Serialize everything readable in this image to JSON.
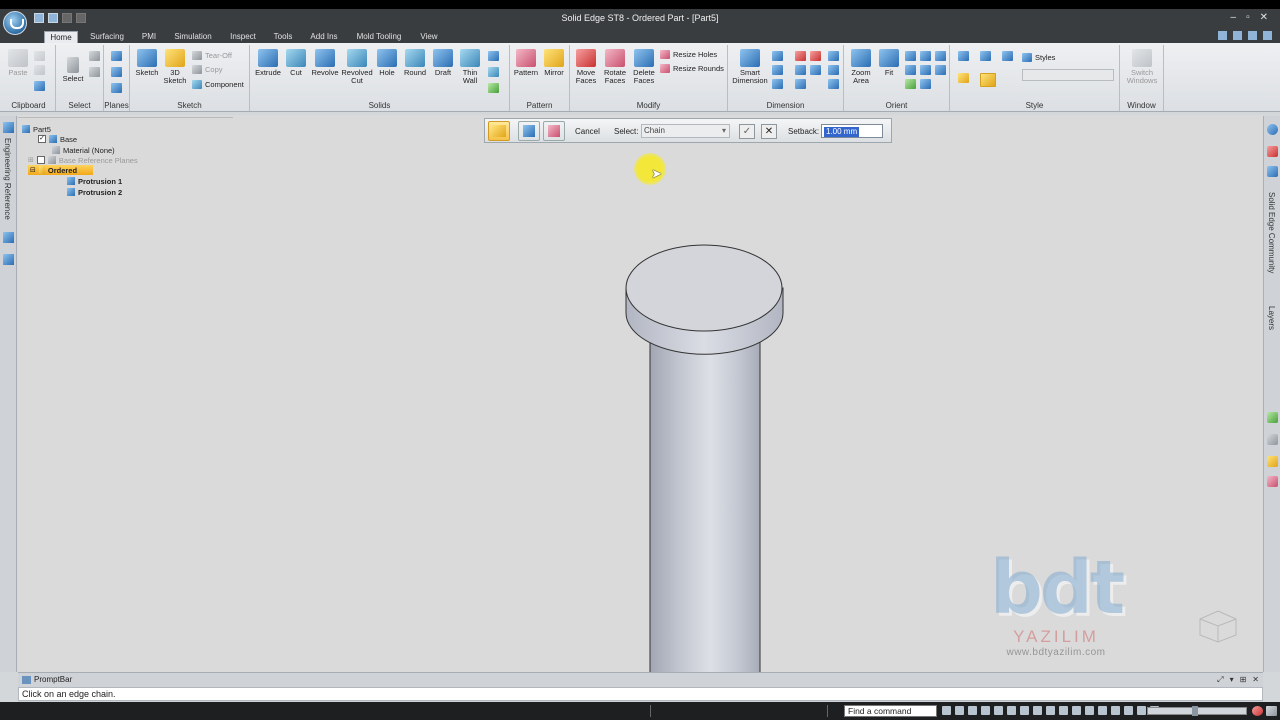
{
  "app": {
    "window_title": "Solid Edge ST8 - Ordered Part - [Part5]",
    "window_controls": [
      "–",
      "▫",
      "✕"
    ]
  },
  "ribbon": {
    "tabs": [
      "Home",
      "Surfacing",
      "PMI",
      "Simulation",
      "Inspect",
      "Tools",
      "Add Ins",
      "Mold Tooling",
      "View"
    ],
    "active_tab": "Home",
    "groups": {
      "clipboard": {
        "label": "Clipboard",
        "paste": "Paste"
      },
      "select": {
        "label": "Select",
        "select": "Select"
      },
      "planes": {
        "label": "Planes"
      },
      "sketch": {
        "label": "Sketch",
        "sketch": "Sketch",
        "sketch3d_l1": "3D",
        "sketch3d_l2": "Sketch",
        "tear_off": "Tear-Off",
        "copy": "Copy",
        "component": "Component"
      },
      "solids": {
        "label": "Solids",
        "extrude": "Extrude",
        "cut": "Cut",
        "revolve": "Revolve",
        "revolved_cut_l1": "Revolved",
        "revolved_cut_l2": "Cut",
        "hole": "Hole",
        "round": "Round",
        "draft": "Draft",
        "thin_wall_l1": "Thin",
        "thin_wall_l2": "Wall"
      },
      "pattern": {
        "label": "Pattern",
        "pattern": "Pattern",
        "mirror": "Mirror"
      },
      "modify": {
        "label": "Modify",
        "move_faces_l1": "Move",
        "move_faces_l2": "Faces",
        "rotate_faces_l1": "Rotate",
        "rotate_faces_l2": "Faces",
        "delete_faces_l1": "Delete",
        "delete_faces_l2": "Faces",
        "resize_holes": "Resize Holes",
        "resize_rounds": "Resize Rounds"
      },
      "dimension": {
        "label": "Dimension",
        "smart_dim_l1": "Smart",
        "smart_dim_l2": "Dimension"
      },
      "orient": {
        "label": "Orient",
        "zoom_area_l1": "Zoom",
        "zoom_area_l2": "Area",
        "fit": "Fit"
      },
      "style": {
        "label": "Style",
        "styles": "Styles"
      },
      "window": {
        "label": "Window",
        "switch_windows_l1": "Switch",
        "switch_windows_l2": "Windows"
      }
    }
  },
  "left_panel": {
    "tab_label": "Engineering Reference"
  },
  "right_panel": {
    "community_label": "Solid Edge Community",
    "layers_label": "Layers"
  },
  "pathfinder": {
    "root": "Part5",
    "items": [
      {
        "label": "Base"
      },
      {
        "label": "Material (None)"
      },
      {
        "label": "Base Reference Planes"
      },
      {
        "label": "Ordered"
      },
      {
        "label": "Protrusion 1"
      },
      {
        "label": "Protrusion 2"
      }
    ]
  },
  "command_bar": {
    "cancel": "Cancel",
    "select_label": "Select:",
    "select_value": "Chain",
    "accept": "✓",
    "close": "✕",
    "setback_label": "Setback:",
    "setback_value": "1.00 mm"
  },
  "watermark": {
    "logo": "bdt",
    "name": "YAZILIM",
    "url": "www.bdtyazilim.com"
  },
  "prompt_bar": {
    "title": "PromptBar",
    "message": "Click on an edge chain."
  },
  "status_bar": {
    "find_command": "Find a command"
  }
}
